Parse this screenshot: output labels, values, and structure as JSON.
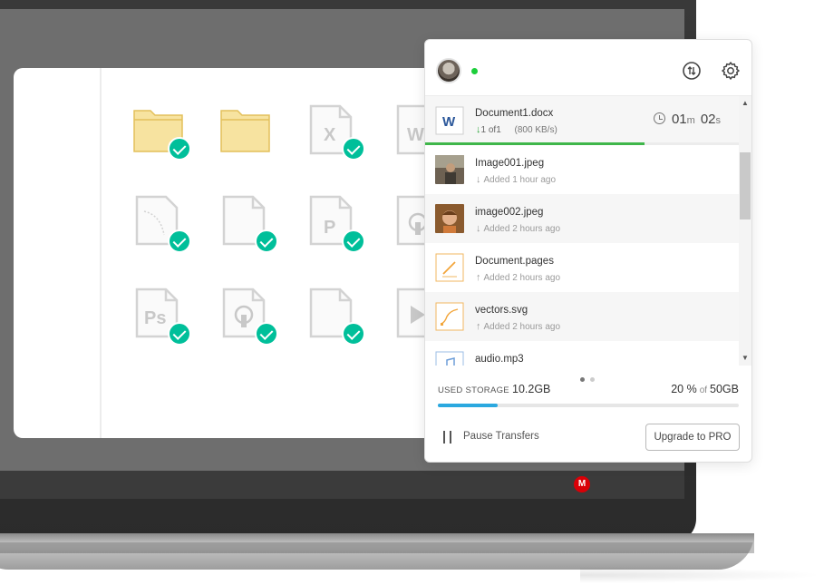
{
  "app": {
    "tray_logo": "M",
    "online": true
  },
  "header": {
    "transfer_icon": "transfer-arrows-icon",
    "settings_icon": "gear-icon"
  },
  "active_transfer": {
    "name": "Document1.docx",
    "file_badge": "W",
    "count_current": "1",
    "count_of": "of",
    "count_total": "1",
    "speed": "(800 KB/s)",
    "timer_min": "01",
    "timer_min_unit": "m",
    "timer_sec": "02",
    "timer_sec_unit": "s",
    "progress": 0.7
  },
  "transfers": [
    {
      "name": "Image001.jpeg",
      "status": "Added 1 hour ago",
      "direction": "down",
      "thumb": "photo"
    },
    {
      "name": "image002.jpeg",
      "status": "Added 2 hours ago",
      "direction": "down",
      "thumb": "photo-child"
    },
    {
      "name": "Document.pages",
      "status": "Added 2 hours ago",
      "direction": "up",
      "thumb": "pages-doc"
    },
    {
      "name": "vectors.svg",
      "status": "Added 2 hours ago",
      "direction": "up",
      "thumb": "vector-doc"
    },
    {
      "name": "audio.mp3",
      "status": "",
      "direction": "",
      "thumb": "audio-doc"
    }
  ],
  "storage": {
    "label": "USED STORAGE",
    "used": "10.2GB",
    "percent": "20 %",
    "of": "of",
    "total": "50GB",
    "fraction": 0.2
  },
  "footer": {
    "pause_label": "Pause Transfers",
    "upgrade_label": "Upgrade to PRO"
  },
  "pager": {
    "pages": 2,
    "current": 1
  },
  "file_grid_badges": {
    "excel": "X",
    "word": "W",
    "powerpoint": "P",
    "photoshop": "Ps"
  },
  "colors": {
    "accent_green": "#00bf9a",
    "progress_green": "#3fb64a",
    "storage_blue": "#2ba8df",
    "brand_red": "#d90007",
    "folder_yellow": "#f7e3a0"
  }
}
